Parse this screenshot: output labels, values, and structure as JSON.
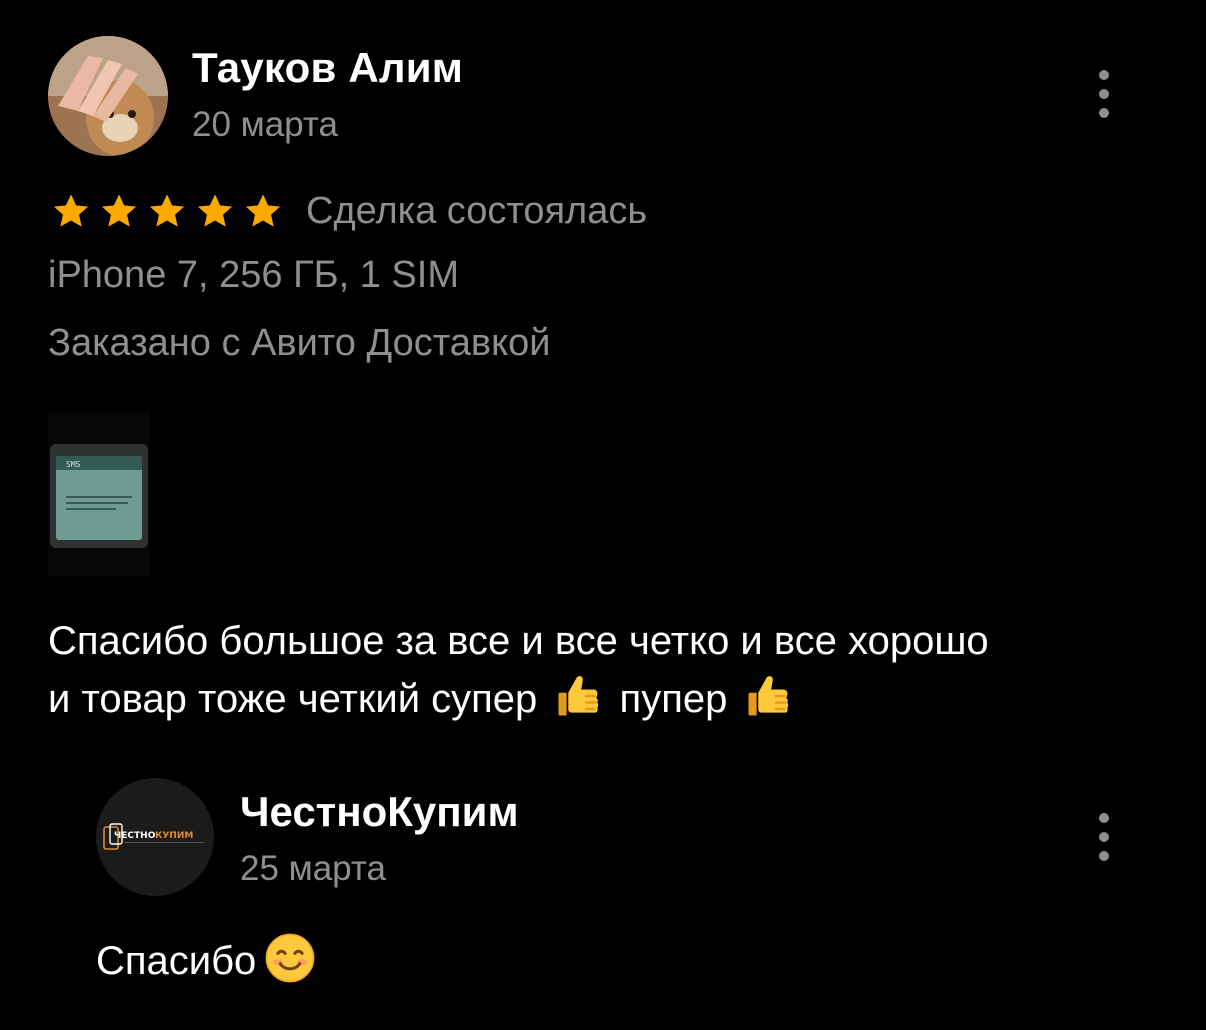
{
  "review": {
    "author_name": "Тауков Алим",
    "date": "20 марта",
    "rating": 5,
    "rating_max": 5,
    "deal_status": "Сделка состоялась",
    "item_spec": "iPhone 7, 256 ГБ, 1 SIM",
    "delivery": "Заказано с Авито Доставкой",
    "text_line1": "Спасибо большое за все и все четко и все хорошо",
    "text_line2_part1": "и товар тоже четкий супер",
    "text_line2_part2": "пупер",
    "photo_screen_label": "SMS",
    "icons": {
      "more": "more-vertical-icon",
      "star": "star-icon",
      "thumbs_up": "thumbs-up-emoji"
    }
  },
  "reply": {
    "seller_name": "ЧестноКупим",
    "date": "25 марта",
    "text": "Спасибо",
    "logo_text_left": "ЧЕСТНО",
    "logo_text_right": "КУПИМ",
    "icons": {
      "more": "more-vertical-icon",
      "smile": "smiling-face-emoji"
    }
  },
  "colors": {
    "background": "#000000",
    "primary_text": "#ffffff",
    "secondary_text": "#8e8e93",
    "star": "#ffa800",
    "logo_accent": "#e08a2a"
  }
}
